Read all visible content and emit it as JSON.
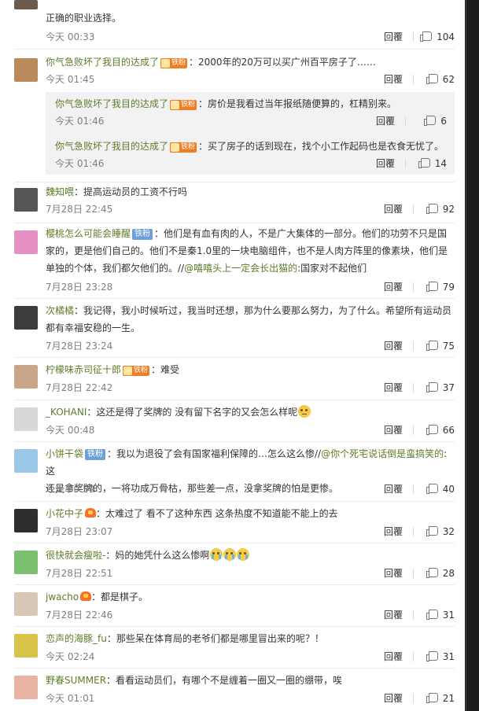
{
  "top_comment": {
    "text_tail": "正确的职业选择。",
    "time": "今天 00:33",
    "reply_label": "回覆",
    "likes": "104"
  },
  "thread": {
    "user": "你气急败坏了我目的达成了",
    "badge": "铁粉",
    "text": "：2000年的20万可以买广州百平房子了……",
    "time": "今天 01:45",
    "reply_label": "回覆",
    "likes": "62",
    "replies": [
      {
        "user": "你气急败坏了我目的达成了",
        "badge": "铁粉",
        "text": "：房价是我看过当年报纸随便算的，杠精别来。",
        "time": "今天 01:46",
        "reply_label": "回覆",
        "likes": "6"
      },
      {
        "user": "你气急败坏了我目的达成了",
        "badge": "铁粉",
        "text": "：买了房子的话到现在，找个小工作起码也是衣食无忧了。",
        "time": "今天 01:46",
        "reply_label": "回覆",
        "likes": "14"
      }
    ]
  },
  "comments": [
    {
      "user": "魏知喂",
      "text": "：提高运动员的工资不行吗",
      "time": "7月28日 22:45",
      "reply_label": "回覆",
      "likes": "92"
    },
    {
      "user": "樱桃怎么可能会睡醒",
      "badge": "铁粉",
      "line1": "：他们是有血有肉的人，不是广大集体的一部分。他们的功劳不只是国",
      "line2": "家的，更是他们自己的。他们不是秦1.0里的一块电脑组件，也不是人肉方阵里的像素块，他们是",
      "line3a": "单独的个体，我们都欠他们的。//",
      "mention": "@嘻嘻头上一定会长出猫的",
      "line3b": ":国家对不起他们",
      "time": "7月28日 23:28",
      "reply_label": "回覆",
      "likes": "79"
    },
    {
      "user": "次橘橘",
      "line1": "：我记得，我小时候听过，我当时还想，那为什么要那么努力，为了什么。希望所有运动员",
      "line2": "都有幸福安稳的一生。",
      "time": "7月28日 23:24",
      "reply_label": "回覆",
      "likes": "75"
    },
    {
      "user": "柠檬味赤司征十郎",
      "badge": "铁粉",
      "text": "：难受",
      "time": "7月28日 22:42",
      "reply_label": "回覆",
      "likes": "37"
    },
    {
      "user": "_KOHANI",
      "text": "：这还是得了奖牌的 没有留下名字的又会怎么样呢",
      "time": "今天 00:48",
      "reply_label": "回覆",
      "likes": "66"
    },
    {
      "user": "小饼干袋",
      "badge": "铁粉",
      "line1a": "：我以为退役了会有国家福利保障的…怎么这么惨//",
      "mention": "@你个死宅说话倒是蛮搞笑的",
      "line1b": ":这",
      "line2": "还是拿奖牌的，一将功成万骨枯，那些差一点，没拿奖牌的怕是更惨。",
      "time": "今天 00:59",
      "reply_label": "回覆",
      "likes": "40"
    },
    {
      "user": "小花中子",
      "text": "：太难过了 看不了这种东西 这条热度不知道能不能上的去",
      "time": "7月28日 23:07",
      "reply_label": "回覆",
      "likes": "32"
    },
    {
      "user": "很快就会瘦啦-",
      "text": "：妈的她凭什么这么惨啊",
      "time": "7月28日 22:51",
      "reply_label": "回覆",
      "likes": "28"
    },
    {
      "user": "jwacho",
      "text": "：都是棋子。",
      "time": "7月28日 22:46",
      "reply_label": "回覆",
      "likes": "31"
    },
    {
      "user": "恋声的海豚_fu",
      "text": "：那些呆在体育局的老爷们都是哪里冒出来的呢？！",
      "time": "今天 02:24",
      "reply_label": "回覆",
      "likes": "31"
    },
    {
      "user": "野春SUMMER",
      "text": "：看看运动员们，有哪个不是缠着一圈又一圈的绷带，唉",
      "time": "今天 01:01",
      "reply_label": "回覆",
      "likes": "21"
    }
  ],
  "colors": {
    "username": "#5e7c28",
    "fan_badge": "#ef7d24",
    "text": "#333333",
    "meta": "#808080"
  }
}
